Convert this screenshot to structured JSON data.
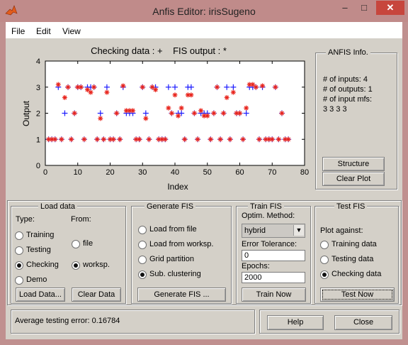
{
  "window": {
    "title": "Anfis Editor: irisSugeno",
    "minimize": "–",
    "maximize": "□",
    "close": "✕"
  },
  "menu": [
    "File",
    "Edit",
    "View"
  ],
  "plot": {
    "title_left": "Checking data : +",
    "title_right": "FIS output : *",
    "ylabel": "Output",
    "xlabel": "Index",
    "xticks": [
      "0",
      "10",
      "20",
      "30",
      "40",
      "50",
      "60",
      "70",
      "80"
    ],
    "yticks": [
      "0",
      "1",
      "2",
      "3",
      "4"
    ]
  },
  "chart_data": {
    "type": "scatter",
    "xlim": [
      0,
      80
    ],
    "ylim": [
      0,
      4
    ],
    "xlabel": "Index",
    "ylabel": "Output",
    "series": [
      {
        "name": "Checking data : +",
        "color": "#1a1aff",
        "marker": "plus",
        "x": [
          1,
          2,
          3,
          4,
          5,
          6,
          7,
          8,
          9,
          10,
          11,
          12,
          13,
          14,
          15,
          16,
          17,
          18,
          19,
          20,
          21,
          22,
          23,
          24,
          25,
          26,
          27,
          28,
          29,
          30,
          31,
          32,
          33,
          34,
          35,
          36,
          37,
          38,
          39,
          40,
          41,
          42,
          43,
          44,
          45,
          46,
          47,
          48,
          49,
          50,
          51,
          52,
          53,
          54,
          55,
          56,
          57,
          58,
          59,
          60,
          61,
          62,
          63,
          64,
          65,
          66,
          67,
          68,
          69,
          70,
          71,
          72,
          73,
          74,
          75
        ],
        "y": [
          1,
          1,
          1,
          3,
          1,
          2,
          3,
          1,
          2,
          3,
          3,
          1,
          3,
          3,
          3,
          1,
          2,
          1,
          3,
          1,
          1,
          2,
          1,
          3,
          2,
          2,
          2,
          1,
          1,
          3,
          2,
          1,
          3,
          3,
          1,
          1,
          1,
          3,
          2,
          3,
          2,
          2,
          1,
          3,
          3,
          2,
          1,
          2,
          2,
          2,
          1,
          2,
          3,
          1,
          2,
          3,
          1,
          3,
          2,
          2,
          1,
          2,
          3,
          3,
          3,
          1,
          3,
          1,
          1,
          1,
          3,
          1,
          2,
          1,
          1
        ]
      },
      {
        "name": "FIS output : *",
        "color": "#e8241c",
        "marker": "star",
        "x": [
          1,
          2,
          3,
          4,
          5,
          6,
          7,
          8,
          9,
          10,
          11,
          12,
          13,
          14,
          15,
          16,
          17,
          18,
          19,
          20,
          21,
          22,
          23,
          24,
          25,
          26,
          27,
          28,
          29,
          30,
          31,
          32,
          33,
          34,
          35,
          36,
          37,
          38,
          39,
          40,
          41,
          42,
          43,
          44,
          45,
          46,
          47,
          48,
          49,
          50,
          51,
          52,
          53,
          54,
          55,
          56,
          57,
          58,
          59,
          60,
          61,
          62,
          63,
          64,
          65,
          66,
          67,
          68,
          69,
          70,
          71,
          72,
          73,
          74,
          75
        ],
        "y": [
          1,
          1,
          1,
          3.1,
          1,
          2.6,
          3,
          1,
          2,
          3,
          3,
          1,
          2.9,
          2.8,
          3,
          1,
          1.8,
          1,
          2.8,
          1,
          1,
          2,
          1,
          3.05,
          2.1,
          2.1,
          2.1,
          1,
          1,
          3,
          1.8,
          1,
          3,
          2.9,
          1,
          1,
          1,
          2.2,
          2,
          2.7,
          1.9,
          2.2,
          1,
          2.7,
          2.7,
          2,
          1,
          2.1,
          1.9,
          1.9,
          1,
          2,
          3,
          1,
          2,
          2.6,
          1,
          2.8,
          2,
          2,
          1,
          2.2,
          3.1,
          3.1,
          3,
          1,
          3.05,
          1,
          1,
          1,
          3,
          1,
          2,
          1,
          1
        ]
      }
    ]
  },
  "info": {
    "title": "ANFIS Info.",
    "lines": [
      "# of inputs: 4",
      "# of outputs: 1",
      "# of input mfs:",
      "3 3 3 3"
    ],
    "structure_button": "Structure",
    "clear_plot_button": "Clear Plot"
  },
  "load": {
    "title": "Load data",
    "type_label": "Type:",
    "from_label": "From:",
    "types": [
      "Training",
      "Testing",
      "Checking",
      "Demo"
    ],
    "selected_type": "Checking",
    "sources": [
      "file",
      "worksp."
    ],
    "selected_source": "worksp.",
    "load_button": "Load Data...",
    "clear_button": "Clear Data"
  },
  "generate": {
    "title": "Generate FIS",
    "options": [
      "Load from file",
      "Load from worksp.",
      "Grid partition",
      "Sub. clustering"
    ],
    "selected": "Sub. clustering",
    "button": "Generate FIS ..."
  },
  "train": {
    "title": "Train FIS",
    "method_label": "Optim. Method:",
    "method": "hybrid",
    "error_label": "Error Tolerance:",
    "error_value": "0",
    "epochs_label": "Epochs:",
    "epochs_value": "2000",
    "button": "Train Now"
  },
  "test": {
    "title": "Test FIS",
    "plot_against_label": "Plot against:",
    "options": [
      "Training data",
      "Testing data",
      "Checking data"
    ],
    "selected": "Checking data",
    "button": "Test Now"
  },
  "status": {
    "text": "Average testing error: 0.16784"
  },
  "footer": {
    "help": "Help",
    "close": "Close"
  }
}
